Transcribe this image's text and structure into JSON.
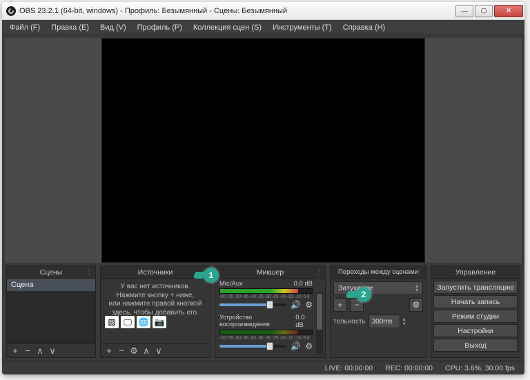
{
  "window": {
    "title": "OBS 23.2.1 (64-bit, windows) - Профиль: Безымянный - Сцены: Безымянный"
  },
  "menubar": [
    "Файл (F)",
    "Правка (E)",
    "Вид (V)",
    "Профиль (P)",
    "Коллекция сцен (S)",
    "Инструменты (T)",
    "Справка (H)"
  ],
  "panels": {
    "scenes": {
      "title": "Сцены",
      "items": [
        "Сцена"
      ]
    },
    "sources": {
      "title": "Источники",
      "hint": "У вас нет источников.\nНажмите кнопку + ниже,\nили нажмите правой кнопкой\nздесь, чтобы добавить его."
    },
    "mixer": {
      "title": "Микшер",
      "channels": [
        {
          "name": "Mic/Aux",
          "db": "0.0 dB",
          "scale": "-60  -55  -50  -45  -40  -35  -30  -25  -20  -15  -10  -5  0"
        },
        {
          "name": "Устройство воспроизведения",
          "db": "0.0 dB",
          "scale": "-60  -55  -50  -45  -40  -35  -30  -25  -20  -15  -10  -5  0"
        }
      ]
    },
    "transitions": {
      "title": "Переходы между сценами",
      "selected": "Затухание",
      "duration_label": "тельность",
      "duration_value": "300ms"
    },
    "controls": {
      "title": "Управление",
      "buttons": [
        "Запустить трансляцию",
        "Начать запись",
        "Режим студии",
        "Настройки",
        "Выход"
      ]
    }
  },
  "status": {
    "live": "LIVE: 00:00:00",
    "rec": "REC: 00:00:00",
    "cpu": "CPU: 3.6%, 30.00 fps"
  },
  "callouts": {
    "c1": "1",
    "c2": "2"
  }
}
